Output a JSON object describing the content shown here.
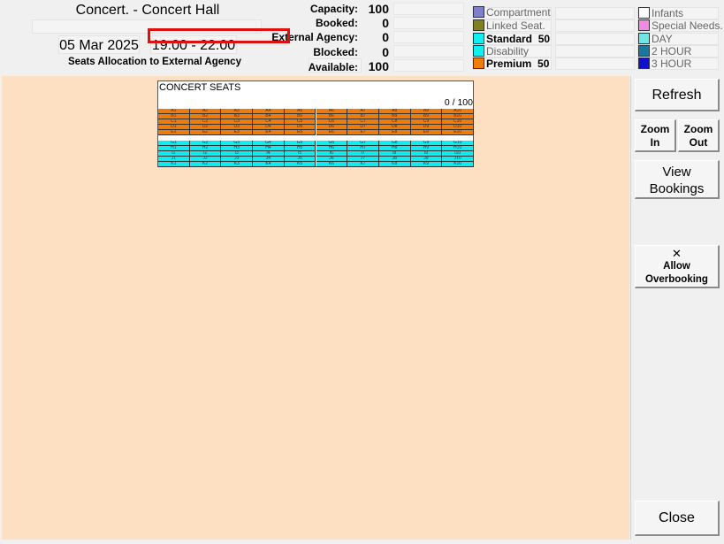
{
  "event": {
    "title": "Concert. - Concert Hall",
    "date": "05 Mar 2025",
    "time": "19:00 - 22:00",
    "allocation_label": "Seats Allocation to External Agency"
  },
  "stats": [
    {
      "label": "Capacity:",
      "value": "100"
    },
    {
      "label": "Booked:",
      "value": "0"
    },
    {
      "label": "External Agency:",
      "value": "0"
    },
    {
      "label": "Blocked:",
      "value": "0"
    },
    {
      "label": "Available:",
      "value": "100"
    }
  ],
  "legend_left": [
    {
      "label": "Compartment",
      "count": "",
      "color": "#8080c8",
      "bold": false
    },
    {
      "label": "Linked Seat.",
      "count": "",
      "color": "#808020",
      "bold": false
    },
    {
      "label": "Standard",
      "count": "50",
      "color": "#10f0f0",
      "bold": true
    },
    {
      "label": "Disability",
      "count": "",
      "color": "#10f0f0",
      "bold": false
    },
    {
      "label": "Premium",
      "count": "50",
      "color": "#f07c0a",
      "bold": true
    }
  ],
  "legend_right": [
    {
      "label": "Infants",
      "color": "#ffffff"
    },
    {
      "label": "Special Needs.",
      "color": "#f08ae6"
    },
    {
      "label": "DAY",
      "color": "#6ee6e6"
    },
    {
      "label": "2 HOUR",
      "color": "#1878a0"
    },
    {
      "label": "3 HOUR",
      "color": "#1010d0"
    }
  ],
  "seat_plan": {
    "title": "CONCERT SEATS",
    "count_text": "0 / 100",
    "premium_rows": [
      "A",
      "B",
      "C",
      "D",
      "E"
    ],
    "standard_rows": [
      "G",
      "H",
      "I",
      "J",
      "K"
    ],
    "columns": 10,
    "premium_color": "#ef7b0a",
    "standard_color": "#10ebf0"
  },
  "buttons": {
    "refresh": "Refresh",
    "zoom_in_1": "Zoom",
    "zoom_in_2": "In",
    "zoom_out_1": "Zoom",
    "zoom_out_2": "Out",
    "view_bookings_1": "View",
    "view_bookings_2": "Bookings",
    "allow_icon": "✕",
    "allow_1": "Allow",
    "allow_2": "Overbooking",
    "close": "Close"
  }
}
